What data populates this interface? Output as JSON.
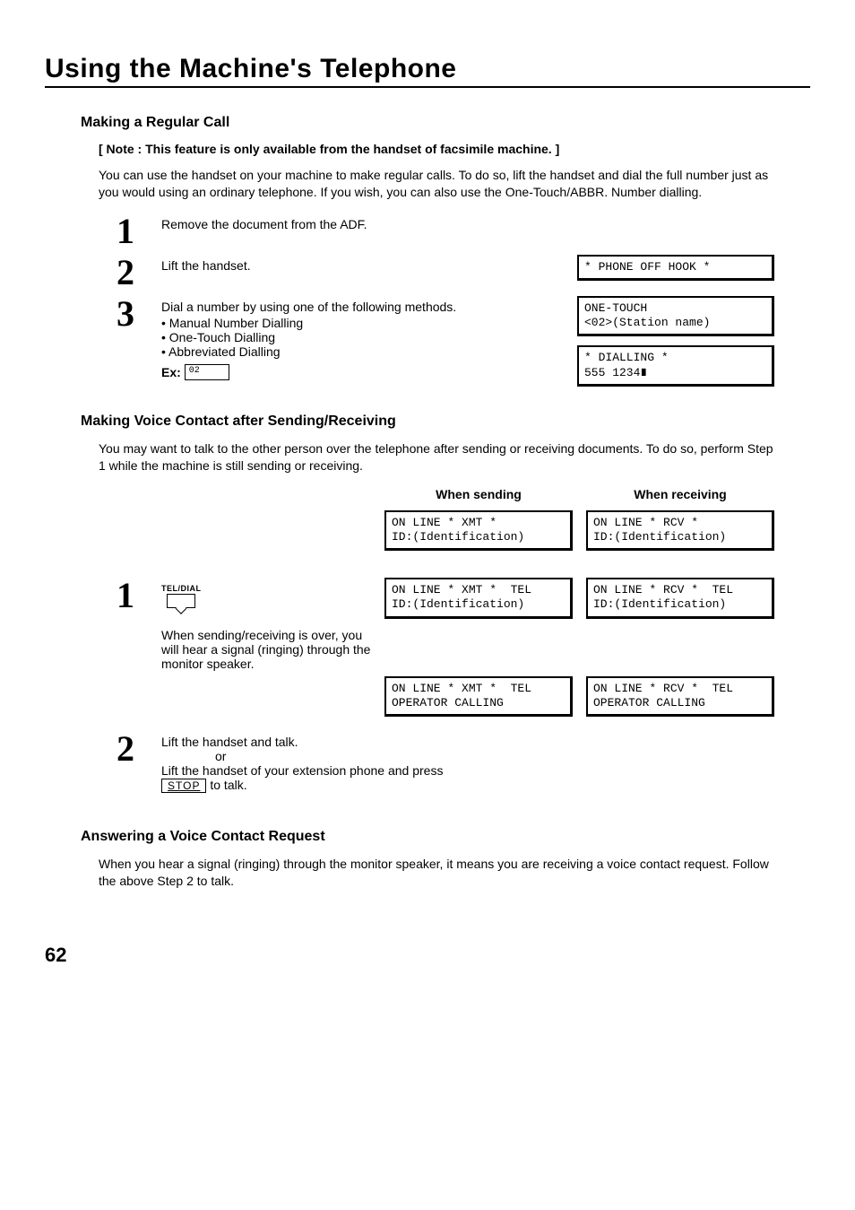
{
  "page_title": "Using the Machine's Telephone",
  "page_number": "62",
  "section1": {
    "heading": "Making a Regular Call",
    "note": "[ Note : This feature is only available from the handset of facsimile machine. ]",
    "intro": "You can use the handset on your machine to make regular calls. To do so, lift the handset and dial the full number just as you would using an ordinary telephone. If you wish, you can also use the One-Touch/ABBR. Number dialling.",
    "steps": [
      {
        "num": "1",
        "text": "Remove the document from the ADF."
      },
      {
        "num": "2",
        "text": "Lift the handset.",
        "lcd": "* PHONE OFF HOOK *"
      },
      {
        "num": "3",
        "text": "Dial a number by using one of the following methods.",
        "bullets": [
          "Manual Number Dialling",
          "One-Touch Dialling",
          "Abbreviated Dialling"
        ],
        "ex_label": "Ex:",
        "ex_value": "02",
        "lcd1": "ONE-TOUCH\n<02>(Station name)",
        "lcd2": "* DIALLING *\n555 1234∎"
      }
    ]
  },
  "section2": {
    "heading": "Making Voice Contact after Sending/Receiving",
    "intro": "You may want to talk to the other person over the telephone after sending or receiving documents. To do so, perform Step 1 while the machine is still sending or receiving.",
    "col_send": "When sending",
    "col_recv": "When receiving",
    "lcd_send_1": "ON LINE * XMT *\nID:(Identification)",
    "lcd_recv_1": "ON LINE * RCV *\nID:(Identification)",
    "tel_dial_label": "TEL/DIAL",
    "lcd_send_2": "ON LINE * XMT *  TEL\nID:(Identification)",
    "lcd_recv_2": "ON LINE * RCV *  TEL\nID:(Identification)",
    "step1_note": "When sending/receiving is over, you will hear a signal (ringing) through the monitor speaker.",
    "lcd_send_3": "ON LINE * XMT *  TEL\nOPERATOR CALLING",
    "lcd_recv_3": "ON LINE * RCV *  TEL\nOPERATOR CALLING",
    "step2_line1": "Lift the handset and talk.",
    "step2_or": "or",
    "step2_line2a": "Lift the handset of your extension phone and press",
    "step2_stop": "STOP",
    "step2_line2b": " to talk.",
    "step_nums": {
      "one": "1",
      "two": "2"
    }
  },
  "section3": {
    "heading": "Answering a Voice Contact Request",
    "body": "When you hear a signal (ringing) through the monitor speaker, it means you are receiving a voice contact request. Follow the above Step 2 to talk."
  }
}
